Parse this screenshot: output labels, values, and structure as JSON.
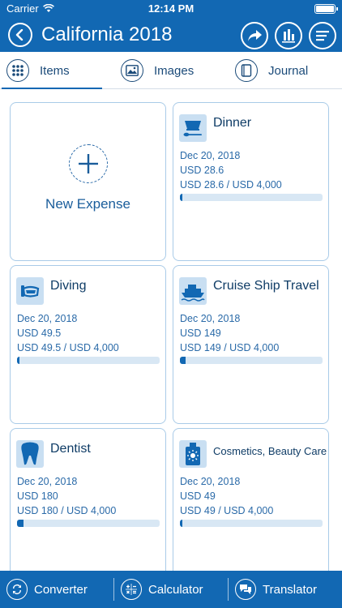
{
  "status": {
    "carrier": "Carrier",
    "time": "12:14 PM"
  },
  "nav": {
    "title": "California 2018"
  },
  "tabs": [
    {
      "label": "Items",
      "icon": "grid-icon"
    },
    {
      "label": "Images",
      "icon": "image-icon"
    },
    {
      "label": "Journal",
      "icon": "journal-icon"
    }
  ],
  "new_expense": {
    "label": "New Expense"
  },
  "expenses": [
    {
      "name": "Dinner",
      "date": "Dec 20, 2018",
      "amount": "USD 28.6",
      "budget": "USD 28.6 / USD 4,000",
      "progress": 0.007,
      "icon": "dinner-icon"
    },
    {
      "name": "Diving",
      "date": "Dec 20, 2018",
      "amount": "USD 49.5",
      "budget": "USD 49.5 / USD 4,000",
      "progress": 0.012,
      "icon": "diving-mask-icon"
    },
    {
      "name": "Cruise Ship Travel",
      "date": "Dec 20, 2018",
      "amount": "USD 149",
      "budget": "USD 149 / USD 4,000",
      "progress": 0.037,
      "icon": "cruise-ship-icon"
    },
    {
      "name": "Dentist",
      "date": "Dec 20, 2018",
      "amount": "USD 180",
      "budget": "USD 180 / USD 4,000",
      "progress": 0.045,
      "icon": "tooth-icon"
    },
    {
      "name": "Cosmetics, Beauty Care",
      "date": "Dec 20, 2018",
      "amount": "USD 49",
      "budget": "USD 49 / USD 4,000",
      "progress": 0.012,
      "icon": "cosmetics-icon"
    }
  ],
  "bottom": [
    {
      "label": "Converter",
      "icon": "converter-icon"
    },
    {
      "label": "Calculator",
      "icon": "calculator-icon"
    },
    {
      "label": "Translator",
      "icon": "translator-icon"
    }
  ],
  "colors": {
    "primary": "#1268b3",
    "card_border": "#a9cbe8",
    "progress_track": "#d8e7f4",
    "text_dark": "#0f3c66",
    "text_blue": "#2a6aa8"
  }
}
